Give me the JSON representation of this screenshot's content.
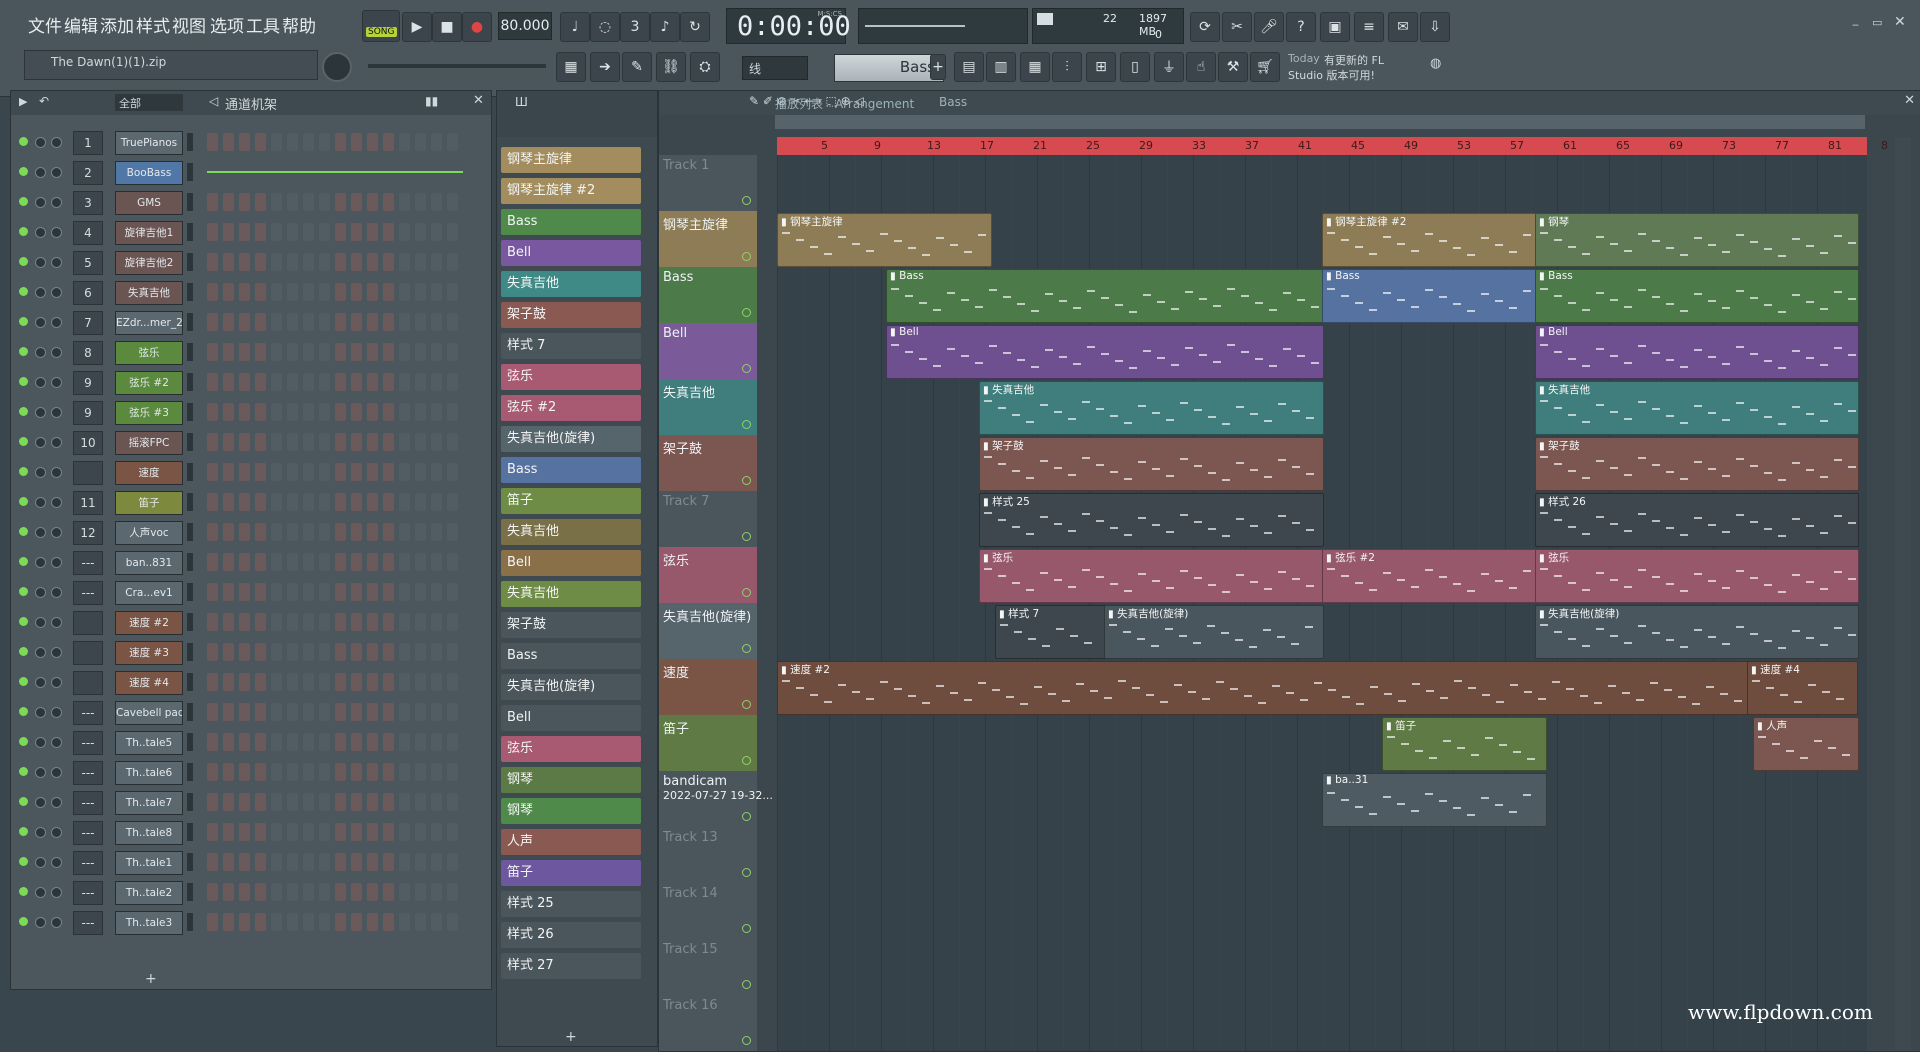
{
  "menu": [
    "文件",
    "编辑",
    "添加",
    "样式",
    "视图",
    "选项",
    "工具",
    "帮助"
  ],
  "transport": {
    "song_label": "SONG",
    "tempo": "80.000",
    "time": "0:00:00",
    "time_unit": "M:S:CS",
    "cpu": "22",
    "memory": "1897 MB",
    "voices": "0"
  },
  "project_file": "The Dawn(1)(1).zip",
  "snap_mode": "线",
  "current_pattern": "Bass",
  "news": {
    "label": "Today",
    "text1": "有更新的 FL",
    "text2": "Studio 版本可用!"
  },
  "channel_rack": {
    "filter": "全部",
    "title": "通道机架",
    "channels": [
      {
        "num": "1",
        "name": "TruePianos",
        "color": "#5b6870"
      },
      {
        "num": "2",
        "name": "BooBass",
        "color": "#5177a6"
      },
      {
        "num": "3",
        "name": "GMS",
        "color": "#6b5553"
      },
      {
        "num": "4",
        "name": "旋律吉他1",
        "color": "#6b5553"
      },
      {
        "num": "5",
        "name": "旋律吉他2",
        "color": "#6b5553"
      },
      {
        "num": "6",
        "name": "失真吉他",
        "color": "#6b5553"
      },
      {
        "num": "7",
        "name": "EZdr...mer_2",
        "color": "#5b6870"
      },
      {
        "num": "8",
        "name": "弦乐",
        "color": "#5b8a3e"
      },
      {
        "num": "9",
        "name": "弦乐 #2",
        "color": "#5b8a3e"
      },
      {
        "num": "9",
        "name": "弦乐 #3",
        "color": "#5b8a3e"
      },
      {
        "num": "10",
        "name": "摇滚FPC",
        "color": "#6b5553"
      },
      {
        "num": "",
        "name": "速度",
        "color": "#7a5545"
      },
      {
        "num": "11",
        "name": "笛子",
        "color": "#7d8a3e"
      },
      {
        "num": "12",
        "name": "人声voc",
        "color": "#5b6870"
      },
      {
        "num": "---",
        "name": "ban..831",
        "color": "#5b6870"
      },
      {
        "num": "---",
        "name": "Cra...ev1",
        "color": "#5b6870"
      },
      {
        "num": "",
        "name": "速度 #2",
        "color": "#7a5545"
      },
      {
        "num": "",
        "name": "速度 #3",
        "color": "#7a5545"
      },
      {
        "num": "",
        "name": "速度 #4",
        "color": "#7a5545"
      },
      {
        "num": "---",
        "name": "Cavebell pad",
        "color": "#5b6870"
      },
      {
        "num": "---",
        "name": "Th..tale5",
        "color": "#5b6870"
      },
      {
        "num": "---",
        "name": "Th..tale6",
        "color": "#5b6870"
      },
      {
        "num": "---",
        "name": "Th..tale7",
        "color": "#5b6870"
      },
      {
        "num": "---",
        "name": "Th..tale8",
        "color": "#5b6870"
      },
      {
        "num": "---",
        "name": "Th..tale1",
        "color": "#5b6870"
      },
      {
        "num": "---",
        "name": "Th..tale2",
        "color": "#5b6870"
      },
      {
        "num": "---",
        "name": "Th..tale3",
        "color": "#5b6870"
      }
    ]
  },
  "pattern_picker": [
    {
      "label": "钢琴主旋律",
      "color": "#a38d5e"
    },
    {
      "label": "钢琴主旋律 #2",
      "color": "#a38d5e"
    },
    {
      "label": "Bass",
      "color": "#4f8a4a"
    },
    {
      "label": "Bell",
      "color": "#7a58a0"
    },
    {
      "label": "失真吉他",
      "color": "#3f8a86"
    },
    {
      "label": "架子鼓",
      "color": "#8a5a52"
    },
    {
      "label": "样式 7",
      "color": "#4a555c"
    },
    {
      "label": "弦乐",
      "color": "#a85a72"
    },
    {
      "label": "弦乐 #2",
      "color": "#a85a72"
    },
    {
      "label": "失真吉他(旋律)",
      "color": "#56646b"
    },
    {
      "label": "Bass",
      "color": "#5572a0"
    },
    {
      "label": "笛子",
      "color": "#6e8c45"
    },
    {
      "label": "失真吉他",
      "color": "#7a7048"
    },
    {
      "label": "Bell",
      "color": "#8a7048"
    },
    {
      "label": "失真吉他",
      "color": "#6e8c45"
    },
    {
      "label": "架子鼓",
      "color": "#4a555c"
    },
    {
      "label": "Bass",
      "color": "#4a555c"
    },
    {
      "label": "失真吉他(旋律)",
      "color": "#4a555c"
    },
    {
      "label": "Bell",
      "color": "#4a555c"
    },
    {
      "label": "弦乐",
      "color": "#a85a72"
    },
    {
      "label": "钢琴",
      "color": "#5c7a45"
    },
    {
      "label": "钢琴",
      "color": "#4f8a4a"
    },
    {
      "label": "人声",
      "color": "#8a5a52"
    },
    {
      "label": "笛子",
      "color": "#6d58a0"
    },
    {
      "label": "样式 25",
      "color": "#4a555c"
    },
    {
      "label": "样式 26",
      "color": "#4a555c"
    },
    {
      "label": "样式 27",
      "color": "#4a555c"
    }
  ],
  "playlist": {
    "title": "播放列表 - Arrangement",
    "breadcrumb": "Bass",
    "ruler": [
      "5",
      "9",
      "13",
      "17",
      "21",
      "25",
      "29",
      "33",
      "37",
      "41",
      "45",
      "49",
      "53",
      "57",
      "61",
      "65",
      "69",
      "73",
      "77",
      "81",
      "8"
    ],
    "tracks": [
      {
        "name": "Track 1",
        "color": "#4a555c"
      },
      {
        "name": "钢琴主旋律",
        "color": "#8d7c55"
      },
      {
        "name": "Bass",
        "color": "#4c7a48"
      },
      {
        "name": "Bell",
        "color": "#7a5a98"
      },
      {
        "name": "失真吉他",
        "color": "#3f7e7c"
      },
      {
        "name": "架子鼓",
        "color": "#7c5650"
      },
      {
        "name": "Track 7",
        "color": "#4a555c"
      },
      {
        "name": "弦乐",
        "color": "#97586c"
      },
      {
        "name": "失真吉他(旋律)",
        "color": "#56646b"
      },
      {
        "name": "速度",
        "color": "#7a5545"
      },
      {
        "name": "笛子",
        "color": "#5f7a45"
      },
      {
        "name": "bandicam",
        "sub": "2022-07-27 19-32...",
        "color": "#4a555c"
      },
      {
        "name": "Track 13",
        "color": "#4a555c"
      },
      {
        "name": "Track 14",
        "color": "#4a555c"
      },
      {
        "name": "Track 15",
        "color": "#4a555c"
      },
      {
        "name": "Track 16",
        "color": "#4a555c"
      }
    ],
    "clips": [
      {
        "track": 1,
        "start": 0.0,
        "end": 0.195,
        "label": "钢琴主旋律",
        "color": "#8d7c55"
      },
      {
        "track": 1,
        "start": 0.5,
        "end": 0.695,
        "label": "钢琴主旋律 #2",
        "color": "#8d7c55"
      },
      {
        "track": 1,
        "start": 0.695,
        "end": 0.99,
        "label": "钢琴",
        "color": "#5f7a55"
      },
      {
        "track": 2,
        "start": 0.1,
        "end": 0.5,
        "label": "Bass",
        "color": "#4c7a48"
      },
      {
        "track": 2,
        "start": 0.5,
        "end": 0.695,
        "label": "Bass",
        "color": "#5572a0"
      },
      {
        "track": 2,
        "start": 0.695,
        "end": 0.99,
        "label": "Bass",
        "color": "#4c7a48"
      },
      {
        "track": 3,
        "start": 0.1,
        "end": 0.5,
        "label": "Bell",
        "color": "#6e5090"
      },
      {
        "track": 3,
        "start": 0.695,
        "end": 0.99,
        "label": "Bell",
        "color": "#6e5090"
      },
      {
        "track": 4,
        "start": 0.185,
        "end": 0.5,
        "label": "失真吉他",
        "color": "#3f7e7c"
      },
      {
        "track": 4,
        "start": 0.695,
        "end": 0.99,
        "label": "失真吉他",
        "color": "#3f7e7c"
      },
      {
        "track": 5,
        "start": 0.185,
        "end": 0.5,
        "label": "架子鼓",
        "color": "#7c5650"
      },
      {
        "track": 5,
        "start": 0.695,
        "end": 0.99,
        "label": "架子鼓",
        "color": "#7c5650"
      },
      {
        "track": 6,
        "start": 0.185,
        "end": 0.5,
        "label": "样式 25",
        "color": "#3d474d"
      },
      {
        "track": 6,
        "start": 0.695,
        "end": 0.99,
        "label": "样式 26",
        "color": "#3d474d"
      },
      {
        "track": 7,
        "start": 0.185,
        "end": 0.5,
        "label": "弦乐",
        "color": "#97586c"
      },
      {
        "track": 7,
        "start": 0.5,
        "end": 0.695,
        "label": "弦乐 #2",
        "color": "#97586c"
      },
      {
        "track": 7,
        "start": 0.695,
        "end": 0.99,
        "label": "弦乐",
        "color": "#97586c"
      },
      {
        "track": 8,
        "start": 0.2,
        "end": 0.3,
        "label": "样式 7",
        "color": "#3d474d"
      },
      {
        "track": 8,
        "start": 0.3,
        "end": 0.5,
        "label": "失真吉他(旋律)",
        "color": "#4a565d"
      },
      {
        "track": 8,
        "start": 0.695,
        "end": 0.99,
        "label": "失真吉他(旋律)",
        "color": "#4a565d"
      },
      {
        "track": 9,
        "start": 0.0,
        "end": 0.89,
        "label": "速度 #2",
        "color": "#6e4c3e"
      },
      {
        "track": 9,
        "start": 0.89,
        "end": 0.99,
        "label": "速度 #4",
        "color": "#6e4c3e"
      },
      {
        "track": 10,
        "start": 0.555,
        "end": 0.705,
        "label": "笛子",
        "color": "#5f7a45"
      },
      {
        "track": 10,
        "start": 0.895,
        "end": 0.99,
        "label": "人声",
        "color": "#7c5650"
      },
      {
        "track": 11,
        "start": 0.5,
        "end": 0.705,
        "label": "ba..31",
        "color": "#4f5b62"
      }
    ]
  },
  "watermark": "www.flpdown.com"
}
